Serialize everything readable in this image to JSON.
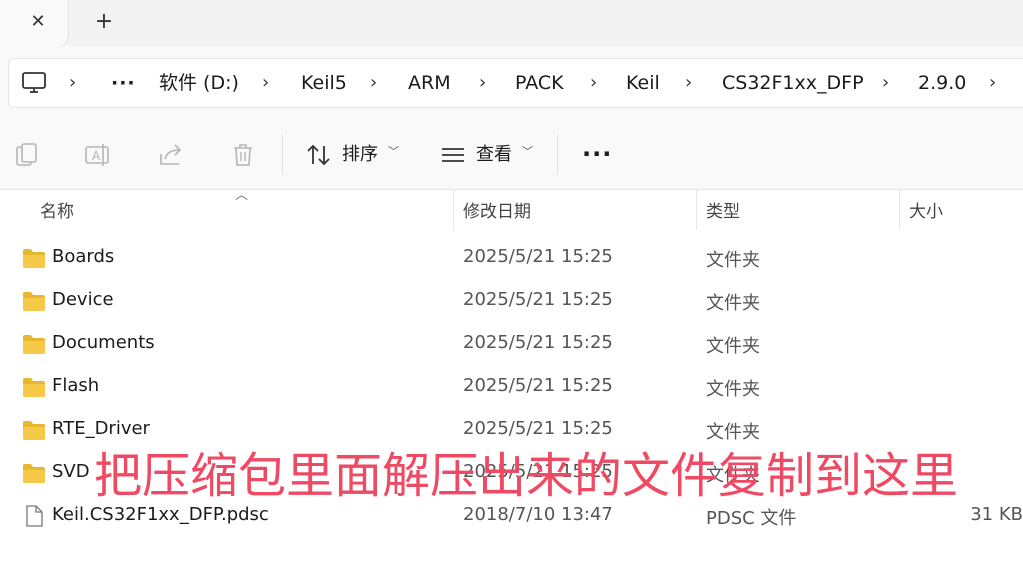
{
  "tabbar": {
    "close_glyph": "✕",
    "new_tab_glyph": "+"
  },
  "address": {
    "more_glyph": "···",
    "crumbs": [
      "软件 (D:)",
      "Keil5",
      "ARM",
      "PACK",
      "Keil",
      "CS32F1xx_DFP",
      "2.9.0"
    ],
    "chevron": "›"
  },
  "toolbar": {
    "sort_label": "排序",
    "view_label": "查看",
    "more_label": "···",
    "icons": [
      "copy-icon",
      "rename-icon",
      "share-icon",
      "delete-icon",
      "sort-icon",
      "view-icon"
    ]
  },
  "columns": {
    "name": "名称",
    "date": "修改日期",
    "type": "类型",
    "size": "大小"
  },
  "files": [
    {
      "name": "Boards",
      "date": "2025/5/21 15:25",
      "type": "文件夹",
      "size": "",
      "kind": "folder"
    },
    {
      "name": "Device",
      "date": "2025/5/21 15:25",
      "type": "文件夹",
      "size": "",
      "kind": "folder"
    },
    {
      "name": "Documents",
      "date": "2025/5/21 15:25",
      "type": "文件夹",
      "size": "",
      "kind": "folder"
    },
    {
      "name": "Flash",
      "date": "2025/5/21 15:25",
      "type": "文件夹",
      "size": "",
      "kind": "folder"
    },
    {
      "name": "RTE_Driver",
      "date": "2025/5/21 15:25",
      "type": "文件夹",
      "size": "",
      "kind": "folder"
    },
    {
      "name": "SVD",
      "date": "2025/5/21 15:25",
      "type": "文件夹",
      "size": "",
      "kind": "folder"
    },
    {
      "name": "Keil.CS32F1xx_DFP.pdsc",
      "date": "2018/7/10 13:47",
      "type": "PDSC 文件",
      "size": "31 KB",
      "kind": "file"
    }
  ],
  "annotation": {
    "text": "把压缩包里面解压出来的文件复制到这里",
    "color": "#ee4a63"
  },
  "colors": {
    "folder": "#f7c948",
    "accent": "#0067c0"
  }
}
